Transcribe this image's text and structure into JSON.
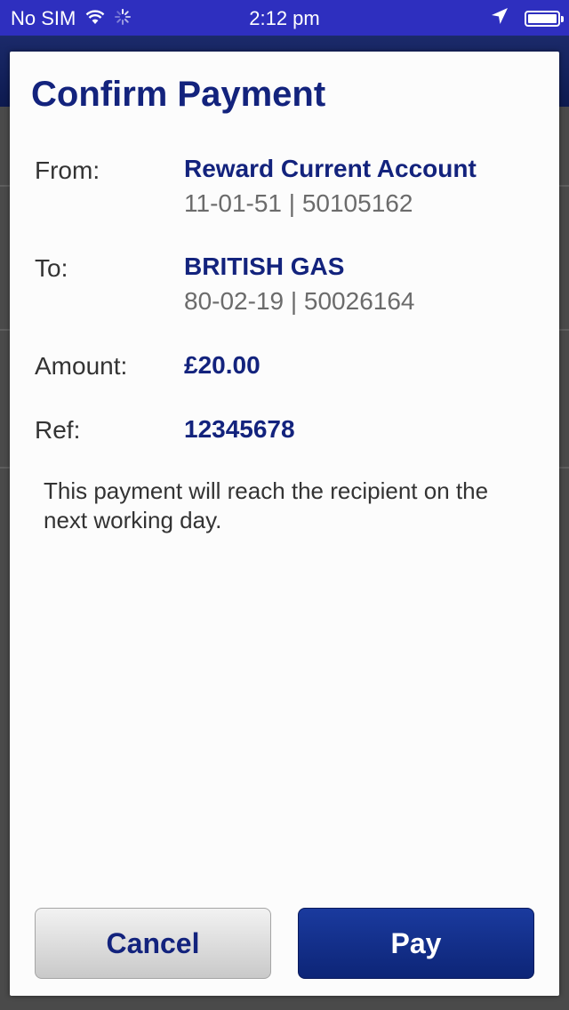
{
  "status_bar": {
    "carrier": "No SIM",
    "time": "2:12 pm",
    "wifi_icon": "wifi-icon",
    "activity_icon": "activity-spinner-icon",
    "location_icon": "location-arrow-icon",
    "battery_icon": "battery-icon"
  },
  "dialog": {
    "title": "Confirm Payment",
    "from": {
      "label": "From:",
      "name": "Reward Current Account",
      "details": "11-01-51 | 50105162"
    },
    "to": {
      "label": "To:",
      "name": "BRITISH GAS",
      "details": "80-02-19 | 50026164"
    },
    "amount": {
      "label": "Amount:",
      "value": "£20.00"
    },
    "ref": {
      "label": "Ref:",
      "value": "12345678"
    },
    "note": "This payment will reach the recipient on the next working day.",
    "cancel_label": "Cancel",
    "pay_label": "Pay"
  },
  "colors": {
    "status_bar": "#2e2fbf",
    "accent": "#13237d",
    "pay_button": "#0d2577"
  }
}
